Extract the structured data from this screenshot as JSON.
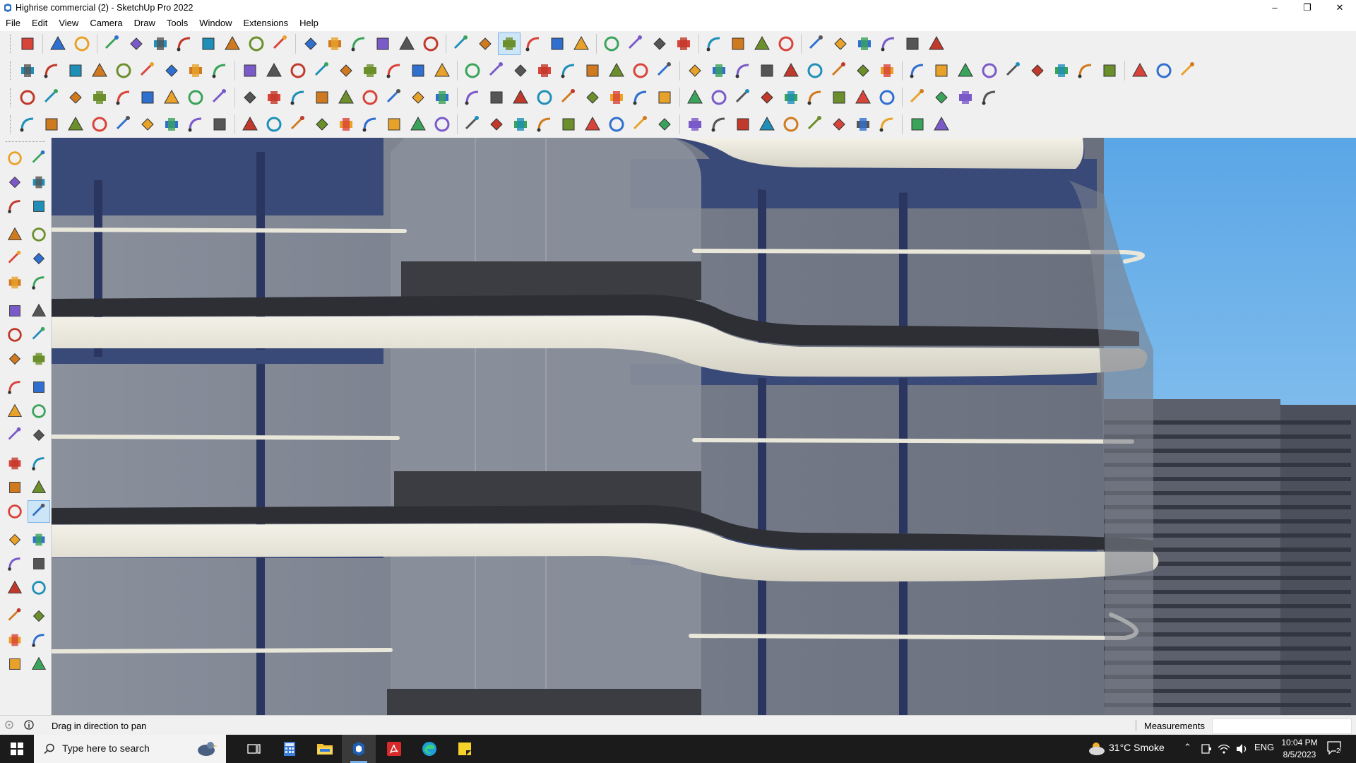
{
  "window": {
    "title": "Highrise commercial (2) - SketchUp Pro 2022",
    "controls": {
      "minimize": "–",
      "maximize": "❐",
      "close": "✕"
    }
  },
  "menu": [
    "File",
    "Edit",
    "View",
    "Camera",
    "Draw",
    "Tools",
    "Window",
    "Extensions",
    "Help"
  ],
  "toolbars": {
    "row1": [
      "zoom",
      "select",
      "select-dropdown",
      "eraser",
      "line",
      "line-dropdown",
      "shapes",
      "shapes-dropdown",
      "push",
      "push-dropdown",
      "move",
      "follow-me",
      "move-arrows",
      "rotate",
      "scale",
      "tape-measure",
      "text",
      "paint",
      "orbit",
      "pan",
      "zoom-in",
      "zoom-extents",
      "view-iso",
      "layers",
      "layer-2",
      "styles",
      "ext-1",
      "ext-2",
      "ext-3",
      "ext-4",
      "ext-5",
      "ext-6",
      "ext-7",
      "ext-8",
      "ext-9",
      "ext-10",
      "ext-11"
    ],
    "row1_active": "pan",
    "row2_count": 48,
    "row3_count": 40,
    "row4_count": 38
  },
  "left_toolbar": {
    "active": "pan",
    "tools": [
      "select",
      "orbit-small",
      "paint-bucket",
      "eraser",
      "component",
      "tape",
      "pencil",
      "freehand",
      "rectangle",
      "rotated-rect",
      "circle",
      "polygon",
      "arc",
      "2pt-arc",
      "pie",
      "3pt-arc",
      "move",
      "push-pull",
      "rotate",
      "follow-me",
      "scale",
      "offset",
      "tape-measure",
      "dimension",
      "protractor",
      "text",
      "axes",
      "3d-text",
      "orbit",
      "pan",
      "zoom",
      "zoom-window",
      "zoom-extents",
      "prev-view",
      "walk",
      "look-around",
      "position-camera",
      "section",
      "layer-a",
      "layer-b",
      "layer-c",
      "layer-d"
    ]
  },
  "status": {
    "hint": "Drag in direction to pan",
    "measurements_label": "Measurements",
    "measurements_value": ""
  },
  "taskbar": {
    "search_placeholder": "Type here to search",
    "weather": "31°C  Smoke",
    "language": "ENG",
    "time": "10:04 PM",
    "date": "8/5/2023",
    "notification_count": "2"
  },
  "colors": {
    "sky": "#7ab8e8",
    "slab": "#e8e6dc",
    "glass": "#7d8593",
    "frame": "#3a4a78",
    "active_tool": "#cde6f7"
  }
}
